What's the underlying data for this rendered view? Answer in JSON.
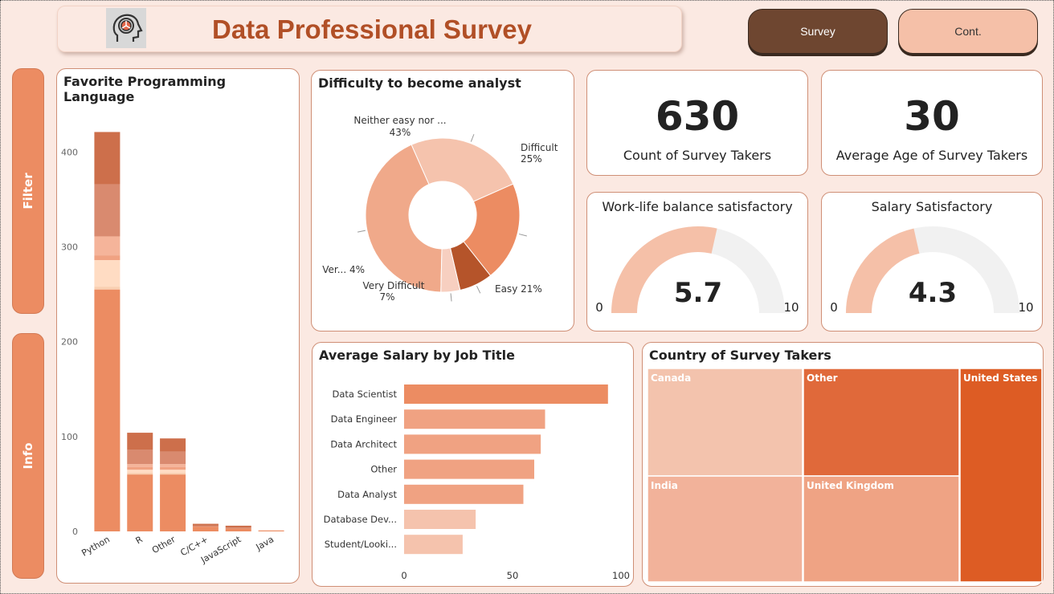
{
  "header": {
    "title": "Data Professional Survey",
    "logo_icon": "head-gear-icon"
  },
  "nav": {
    "survey_label": "Survey",
    "cont_label": "Cont."
  },
  "side": {
    "filter_label": "Filter",
    "info_label": "Info"
  },
  "kpis": {
    "count": {
      "value": "630",
      "label": "Count of Survey Takers"
    },
    "age": {
      "value": "30",
      "label": "Average Age of Survey Takers"
    }
  },
  "gauges": {
    "work_life": {
      "title": "Work-life balance satisfactory",
      "value": 5.7,
      "value_text": "5.7",
      "min": "0",
      "max": "10"
    },
    "salary": {
      "title": "Salary Satisfactory",
      "value": 4.3,
      "value_text": "4.3",
      "min": "0",
      "max": "10"
    }
  },
  "colors": {
    "accent": "#ec8c62",
    "dark_accent": "#6e4630",
    "title": "#b14f26",
    "gauge_fill": "#f5c0a8",
    "gauge_bg": "#f1f1f1"
  },
  "chart_data": [
    {
      "type": "bar",
      "stacked": true,
      "title": "Favorite Programming Language",
      "categories": [
        "Python",
        "R",
        "Other",
        "C/C++",
        "JavaScript",
        "Java"
      ],
      "ylim": [
        0,
        440
      ],
      "yticks": [
        0,
        100,
        200,
        300,
        400
      ],
      "segment_colors": [
        "#ec8c62",
        "#f9cfb1",
        "#ffdcc3",
        "#f0a282",
        "#f5b49a",
        "#d98a6f",
        "#cd6f4b"
      ],
      "segments": [
        [
          255,
          3,
          28,
          5,
          20,
          55,
          55
        ],
        [
          60,
          2,
          3,
          3,
          3,
          15,
          18
        ],
        [
          60,
          2,
          3,
          3,
          3,
          13,
          14
        ],
        [
          5,
          0,
          0,
          0,
          0,
          1,
          2
        ],
        [
          3,
          0,
          0,
          0,
          0,
          1,
          2
        ],
        [
          1,
          0,
          0,
          0,
          0,
          0,
          0
        ]
      ]
    },
    {
      "type": "pie",
      "donut": true,
      "title": "Difficulty to become analyst",
      "slices": [
        {
          "label": "Neither easy nor ...",
          "percent_text": "43%",
          "value": 43,
          "color": "#f0a98a"
        },
        {
          "label": "Difficult",
          "percent_text": "25%",
          "value": 25,
          "color": "#f5c3ad"
        },
        {
          "label": "Easy",
          "percent_text": "21%",
          "value": 21,
          "color": "#ec8c62"
        },
        {
          "label": "Very Difficult",
          "percent_text": "7%",
          "value": 7,
          "color": "#b5542a"
        },
        {
          "label": "Ver...",
          "percent_text": "4%",
          "value": 4,
          "color": "#f7cfc0"
        }
      ]
    },
    {
      "type": "bar",
      "orientation": "horizontal",
      "title": "Average Salary by Job Title",
      "categories": [
        "Data Scientist",
        "Data Engineer",
        "Data Architect",
        "Other",
        "Data Analyst",
        "Database Dev...",
        "Student/Looki..."
      ],
      "values": [
        94,
        65,
        63,
        60,
        55,
        33,
        27
      ],
      "colors": [
        "#ec8c62",
        "#f0a282",
        "#f0a282",
        "#f0a282",
        "#f0a282",
        "#f5c3ad",
        "#f5c3ad"
      ],
      "xlim": [
        0,
        100
      ],
      "xticks": [
        0,
        50,
        100
      ]
    },
    {
      "type": "treemap",
      "title": "Country of Survey Takers",
      "tiles": [
        {
          "label": "Canada",
          "color": "#f3c3ad"
        },
        {
          "label": "Other",
          "color": "#e0693a"
        },
        {
          "label": "United States",
          "color": "#dd5c24"
        },
        {
          "label": "India",
          "color": "#f2b29a"
        },
        {
          "label": "United Kingdom",
          "color": "#efa384"
        }
      ]
    }
  ]
}
